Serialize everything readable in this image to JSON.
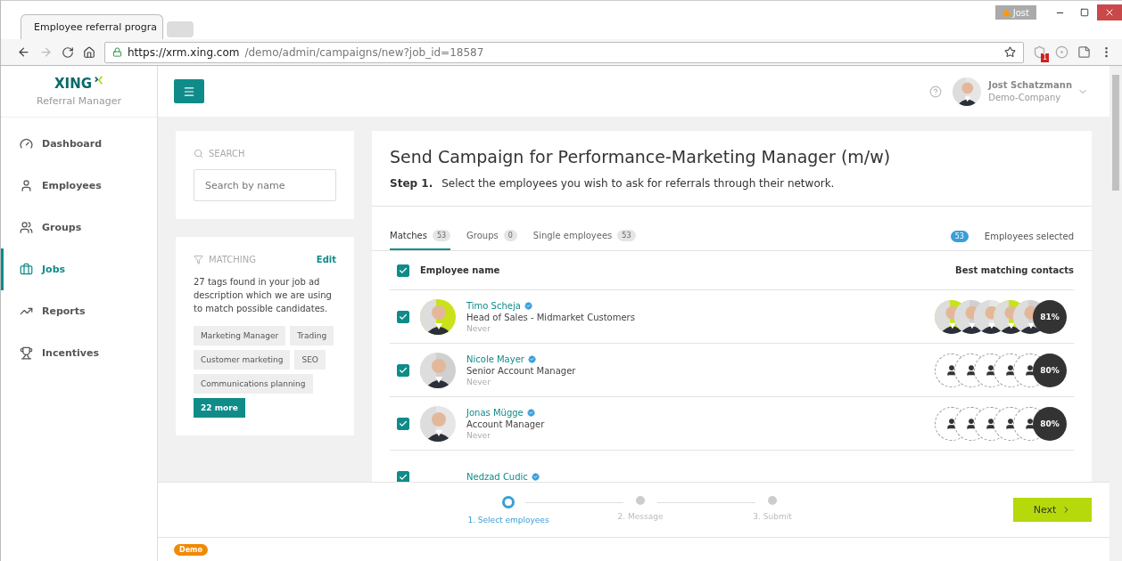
{
  "browser": {
    "tab_title": "Employee referral progra",
    "profile": "Jost",
    "url_host": "https://xrm.xing.com",
    "url_path": "/demo/admin/campaigns/new?job_id=18587",
    "extension_badge": "1"
  },
  "brand": {
    "logo": "XING",
    "subtitle": "Referral Manager"
  },
  "sidebar": {
    "items": [
      {
        "label": "Dashboard",
        "selected": false
      },
      {
        "label": "Employees",
        "selected": false
      },
      {
        "label": "Groups",
        "selected": false
      },
      {
        "label": "Jobs",
        "selected": true
      },
      {
        "label": "Reports",
        "selected": false
      },
      {
        "label": "Incentives",
        "selected": false
      }
    ]
  },
  "user": {
    "name": "Jost Schatzmann",
    "company": "Demo-Company"
  },
  "search": {
    "heading": "SEARCH",
    "placeholder": "Search by name"
  },
  "matching": {
    "heading": "MATCHING",
    "edit": "Edit",
    "description": "27 tags found in your job ad description which we are using to match possible candidates.",
    "tags": [
      "Marketing Manager",
      "Trading",
      "Customer marketing",
      "SEO",
      "Communications planning"
    ],
    "more": "22 more"
  },
  "campaign": {
    "title": "Send Campaign for Performance-Marketing Manager (m/w)",
    "step_label": "Step 1.",
    "step_text": "Select the employees you wish to ask for referrals through their network.",
    "tabs": [
      {
        "label": "Matches",
        "count": "53",
        "selected": true
      },
      {
        "label": "Groups",
        "count": "0",
        "selected": false
      },
      {
        "label": "Single employees",
        "count": "53",
        "selected": false
      }
    ],
    "selected_count": "53",
    "selected_label": "Employees selected",
    "columns": [
      "Employee name",
      "Best matching contacts"
    ],
    "all_checked": true,
    "rows": [
      {
        "kind": "photos",
        "name": "Timo Scheja",
        "role": "Head of Sales - Midmarket Customers",
        "last": "Never",
        "checked": true,
        "score": "81%"
      },
      {
        "kind": "placeholder",
        "name": "Nicole Mayer",
        "role": "Senior Account Manager",
        "last": "Never",
        "checked": true,
        "score": "80%"
      },
      {
        "kind": "placeholder",
        "name": "Jonas Mügge",
        "role": "Account Manager",
        "last": "Never",
        "checked": true,
        "score": "80%"
      },
      {
        "kind": "cut",
        "name": "Nedzad Cudic",
        "checked": true
      }
    ]
  },
  "stepper": {
    "steps": [
      {
        "label": "1. Select employees",
        "selected": true
      },
      {
        "label": "2. Message",
        "selected": false
      },
      {
        "label": "3. Submit",
        "selected": false
      }
    ],
    "next": "Next"
  },
  "footer": {
    "badge": "Demo"
  }
}
